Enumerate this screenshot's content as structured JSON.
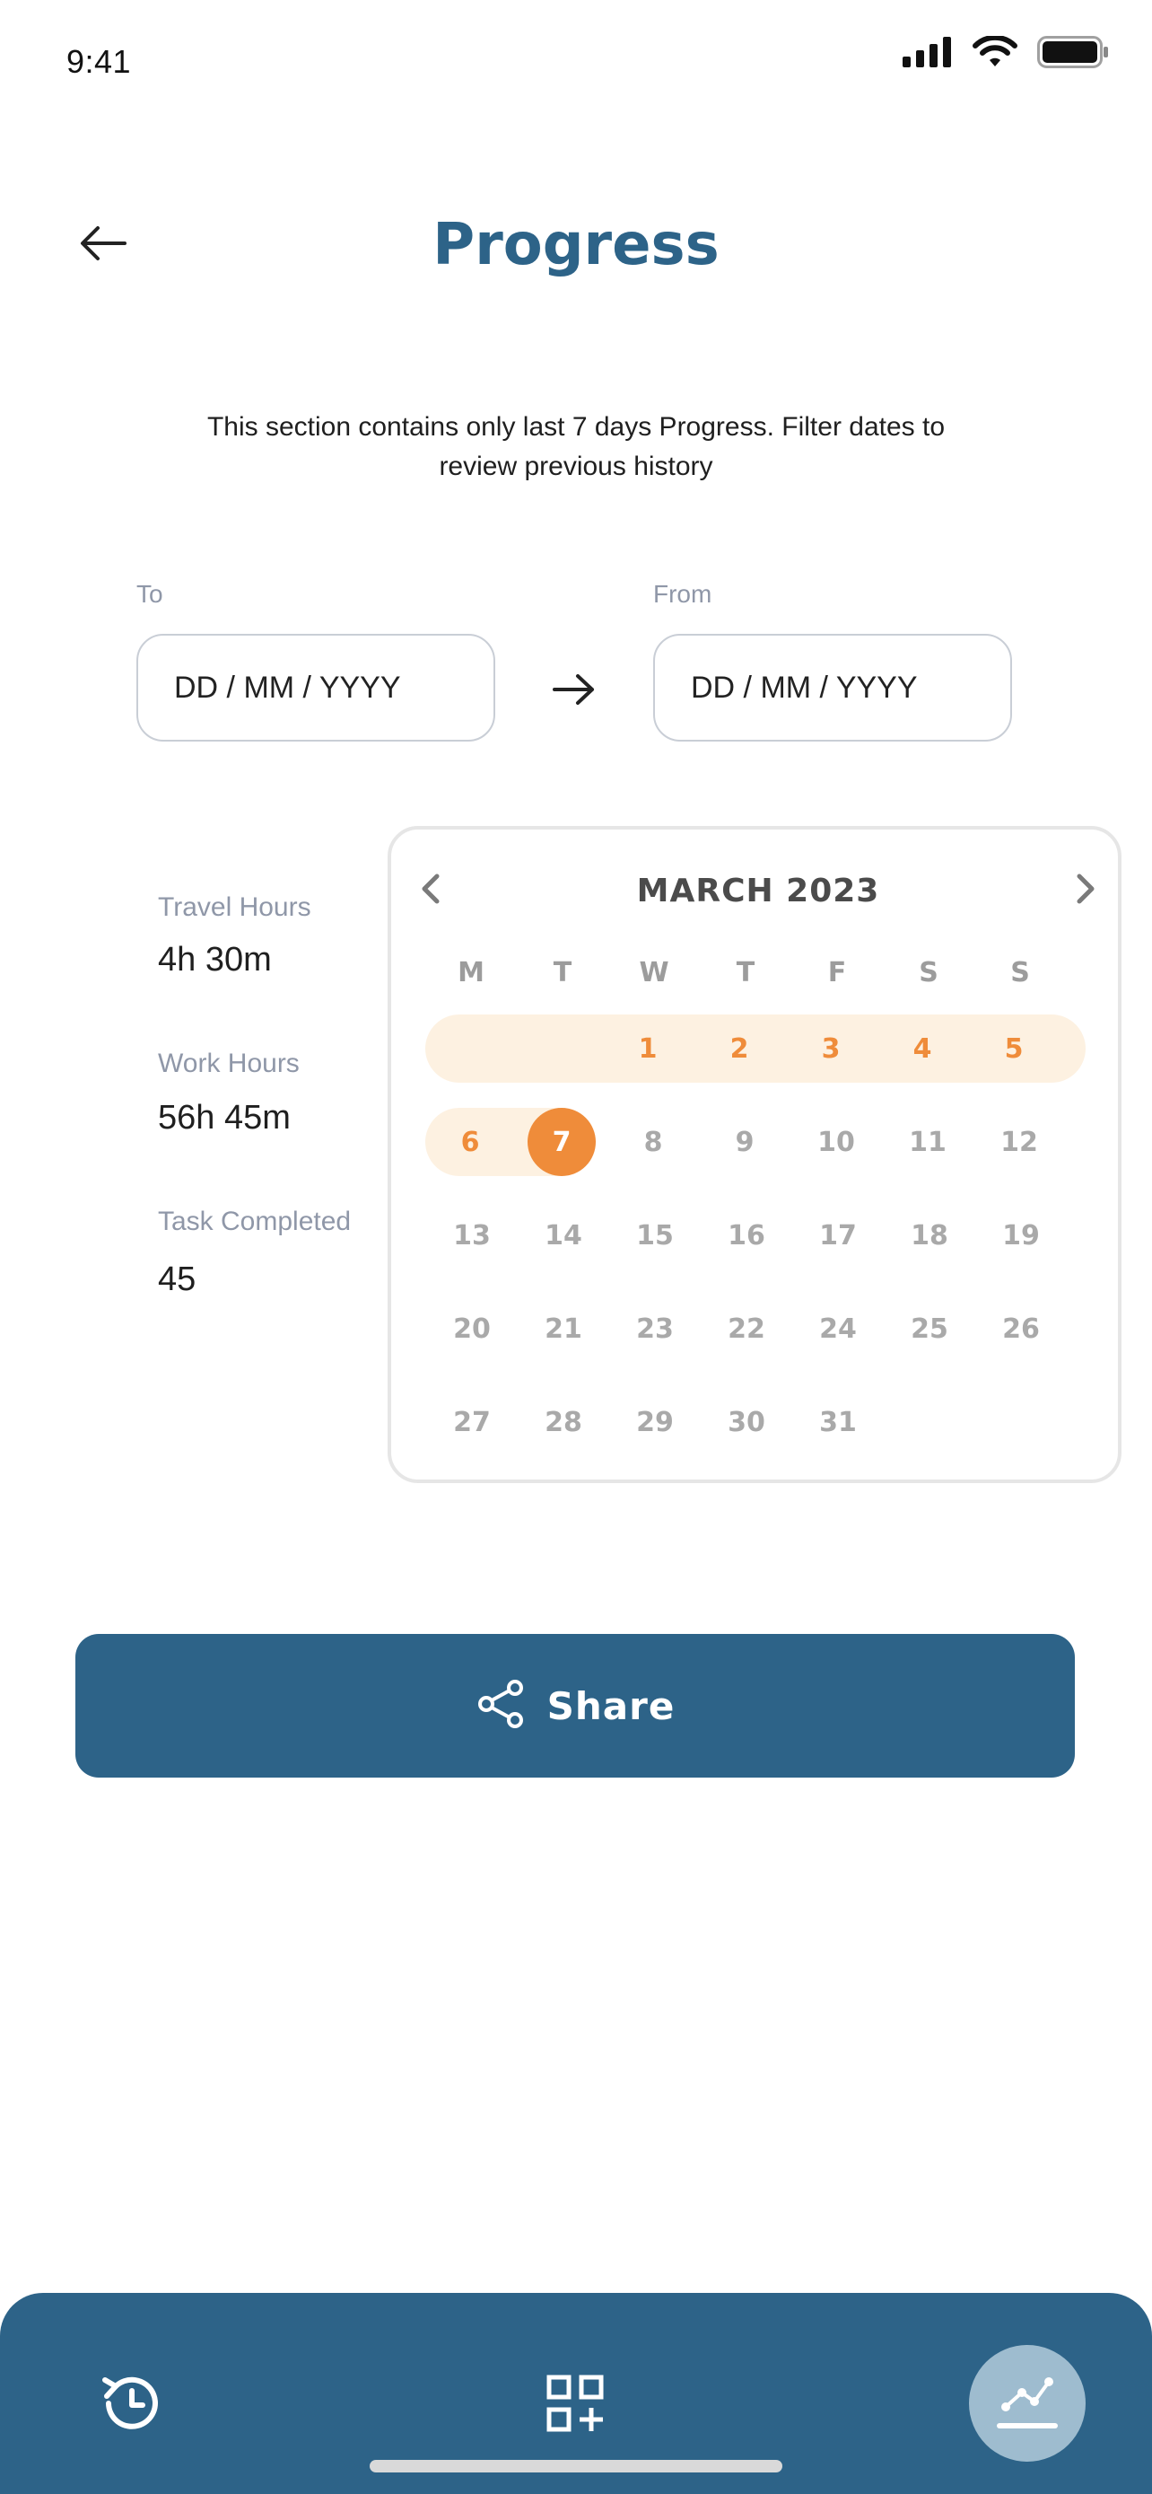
{
  "status_bar": {
    "time": "9:41"
  },
  "header": {
    "title": "Progress"
  },
  "subtitle": "This section contains only last 7 days Progress. Filter dates to review previous history",
  "date_range": {
    "to_label": "To",
    "to_placeholder": "DD / MM / YYYY",
    "from_label": "From",
    "from_placeholder": "DD / MM / YYYY"
  },
  "stats": [
    {
      "label": "Travel Hours",
      "value": "4h 30m"
    },
    {
      "label": "Work Hours",
      "value": "56h 45m"
    },
    {
      "label": "Task Completed",
      "value": "45"
    }
  ],
  "calendar": {
    "month_title": "MARCH 2023",
    "weekdays": [
      "M",
      "T",
      "W",
      "T",
      "F",
      "S",
      "S"
    ],
    "weeks": [
      [
        "",
        "",
        "1",
        "2",
        "3",
        "4",
        "5"
      ],
      [
        "6",
        "7",
        "8",
        "9",
        "10",
        "11",
        "12"
      ],
      [
        "13",
        "14",
        "15",
        "16",
        "17",
        "18",
        "19"
      ],
      [
        "20",
        "21",
        "23",
        "22",
        "24",
        "25",
        "26"
      ],
      [
        "27",
        "28",
        "29",
        "30",
        "31",
        "",
        ""
      ]
    ],
    "highlighted_range": [
      "1",
      "2",
      "3",
      "4",
      "5",
      "6",
      "7"
    ],
    "selected_day": "7",
    "accent_color": "#ef8c3a",
    "range_band_color": "#fdf1e1"
  },
  "share_button": {
    "label": "Share"
  },
  "bottom_nav": {
    "items": [
      {
        "icon": "history-icon",
        "active": false
      },
      {
        "icon": "add-widget-icon",
        "active": false
      },
      {
        "icon": "progress-chart-icon",
        "active": true
      }
    ]
  },
  "colors": {
    "primary": "#2d6388",
    "accent": "#ef8c3a",
    "muted_text": "#8f97a8"
  }
}
